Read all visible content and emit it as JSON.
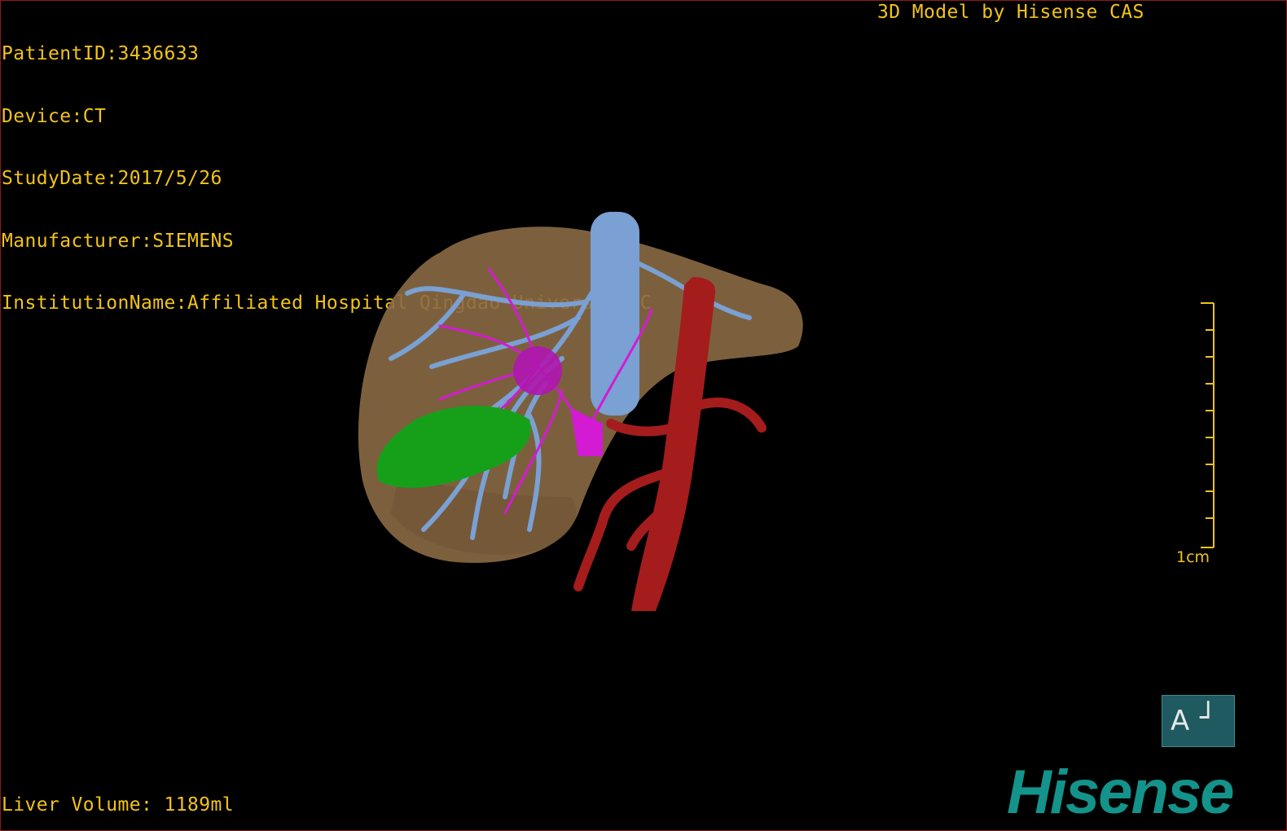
{
  "header": {
    "patient_id": "PatientID:3436633",
    "device": "Device:CT",
    "study_date": "StudyDate:2017/5/26",
    "manufacturer": "Manufacturer:SIEMENS",
    "institution": "InstitutionName:Affiliated Hospital Qingdao University-C"
  },
  "credit": "3D Model by Hisense CAS",
  "footer": {
    "liver_volume": "Liver Volume: 1189ml"
  },
  "scale": {
    "label": "1cm",
    "ticks": 10
  },
  "orientation": {
    "letter": "A",
    "symbol": "┘"
  },
  "brand": {
    "name": "Hisense"
  },
  "colors": {
    "text": "#f2c318",
    "liver": "#8a6a44",
    "portal_vein": "#7aa0d4",
    "hepatic_artery": "#d21bd2",
    "aorta": "#a51c1c",
    "gallbladder": "#16a01a",
    "brand": "#13938a"
  }
}
